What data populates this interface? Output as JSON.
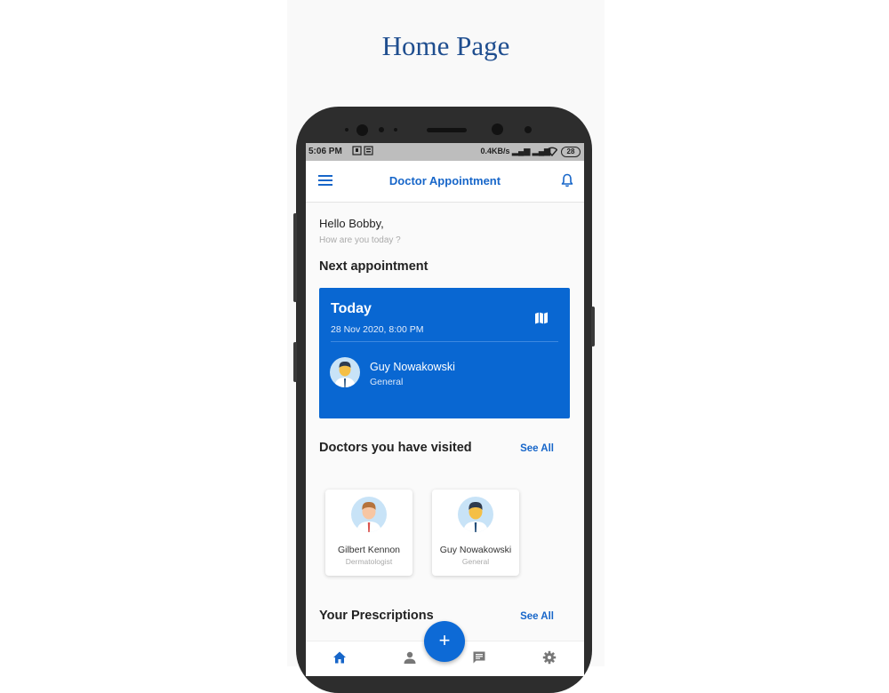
{
  "page_heading": "Home Page",
  "status_bar": {
    "time": "5:06 PM",
    "network_speed": "0.4KB/s",
    "battery": "28"
  },
  "app_bar": {
    "title": "Doctor Appointment",
    "menu_icon": "hamburger-menu-icon",
    "notification_icon": "bell-icon"
  },
  "greeting": {
    "hello": "Hello Bobby,",
    "subtitle": "How are you today ?"
  },
  "next_appointment": {
    "section_title": "Next appointment",
    "day": "Today",
    "datetime": "28 Nov 2020, 8:00 PM",
    "map_icon": "map-icon",
    "doctor_name": "Guy Nowakowski",
    "doctor_specialty": "General"
  },
  "visited_doctors": {
    "section_title": "Doctors you have visited",
    "see_all": "See All",
    "doctors": [
      {
        "name": "Gilbert Kennon",
        "specialty": "Dermatologist"
      },
      {
        "name": "Guy Nowakowski",
        "specialty": "General"
      }
    ]
  },
  "prescriptions": {
    "section_title": "Your Prescriptions",
    "see_all": "See All"
  },
  "bottom_nav": {
    "items": [
      "home-icon",
      "profile-icon",
      "chat-icon",
      "settings-icon"
    ],
    "fab_label": "+"
  },
  "colors": {
    "primary": "#0967d2",
    "heading": "#1f4e8f",
    "accent_text": "#1766c9"
  }
}
